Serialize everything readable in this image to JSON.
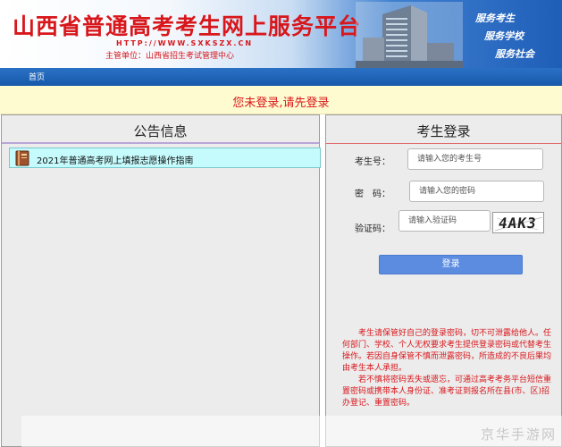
{
  "header": {
    "title": "山西省普通高考考生网上服务平台",
    "url": "HTTP://WWW.SXKSZX.CN",
    "organizer": "主管单位：山西省招生考试管理中心",
    "slogans": [
      "服务考生",
      "服务学校",
      "服务社会"
    ]
  },
  "nav": {
    "home": "首页"
  },
  "notice": {
    "text": "您未登录,请先登录"
  },
  "announcements": {
    "title": "公告信息",
    "items": [
      "2021年普通高考网上填报志愿操作指南"
    ]
  },
  "login": {
    "title": "考生登录",
    "exam_no_label": "考生号：",
    "exam_no_placeholder": "请输入您的考生号",
    "password_label": "密　码：",
    "password_placeholder": "请输入您的密码",
    "captcha_label": "验证码：",
    "captcha_placeholder": "请输入验证码",
    "captcha_text": "4AK3",
    "submit_label": "登录"
  },
  "tips": [
    "考生请保管好自己的登录密码，切不可泄露给他人。任何部门、学校、个人无权要求考生提供登录密码或代替考生操作。若因自身保管不慎而泄露密码，所造成的不良后果均由考生本人承担。",
    "若不慎将密码丢失或遗忘，可通过高考考务平台短信重置密码或携带本人身份证、准考证到报名所在县(市、区)招办登记、重置密码。"
  ],
  "watermark": "京华手游网",
  "colors": {
    "title_red": "#d8171c",
    "nav_blue": "#1f63b8",
    "button_blue": "#5b8ce0",
    "notice_bg": "#fffbd0",
    "news_bg": "#c6fbfd"
  },
  "icons": {
    "news": "book-icon"
  }
}
